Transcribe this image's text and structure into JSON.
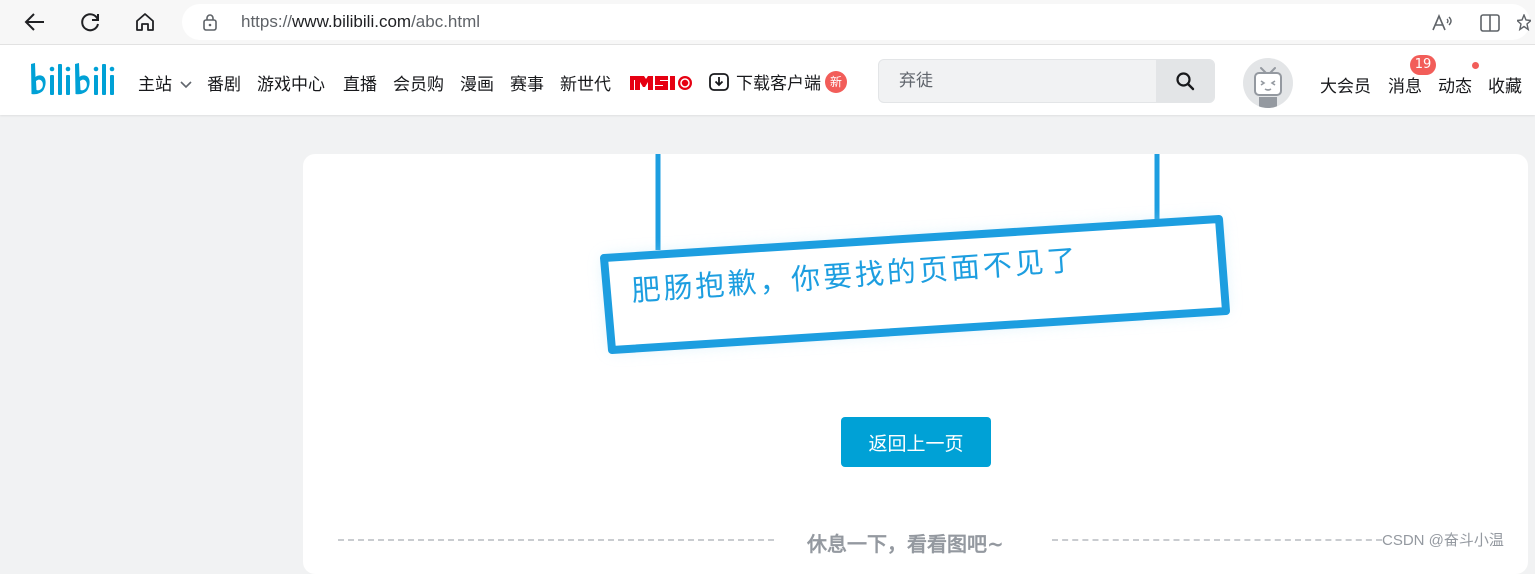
{
  "browser": {
    "url_prefix": "https://",
    "url_host": "www.bilibili.com",
    "url_path": "/abc.html"
  },
  "header": {
    "logo_icon": "bilibili-logo",
    "nav": [
      {
        "label": "主站"
      },
      {
        "label": "番剧"
      },
      {
        "label": "游戏中心"
      },
      {
        "label": "直播"
      },
      {
        "label": "会员购"
      },
      {
        "label": "漫画"
      },
      {
        "label": "赛事"
      },
      {
        "label": "新世代"
      }
    ],
    "sponsor_logo": "MSI",
    "download_label": "下载客户端",
    "new_badge": "新",
    "search_placeholder": "弃徒",
    "right": {
      "vip": "大会员",
      "messages": "消息",
      "messages_count": "19",
      "dynamics": "动态",
      "favorites": "收藏"
    }
  },
  "content": {
    "error_message": "肥肠抱歉，你要找的页面不见了",
    "back_button": "返回上一页",
    "rest_hint": "休息一下，看看图吧~"
  },
  "watermark": "CSDN @奋斗小温",
  "colors": {
    "accent": "#00a1d6",
    "sign": "#1d9ee0",
    "badge": "#f25d59",
    "page_bg": "#f1f2f3"
  }
}
